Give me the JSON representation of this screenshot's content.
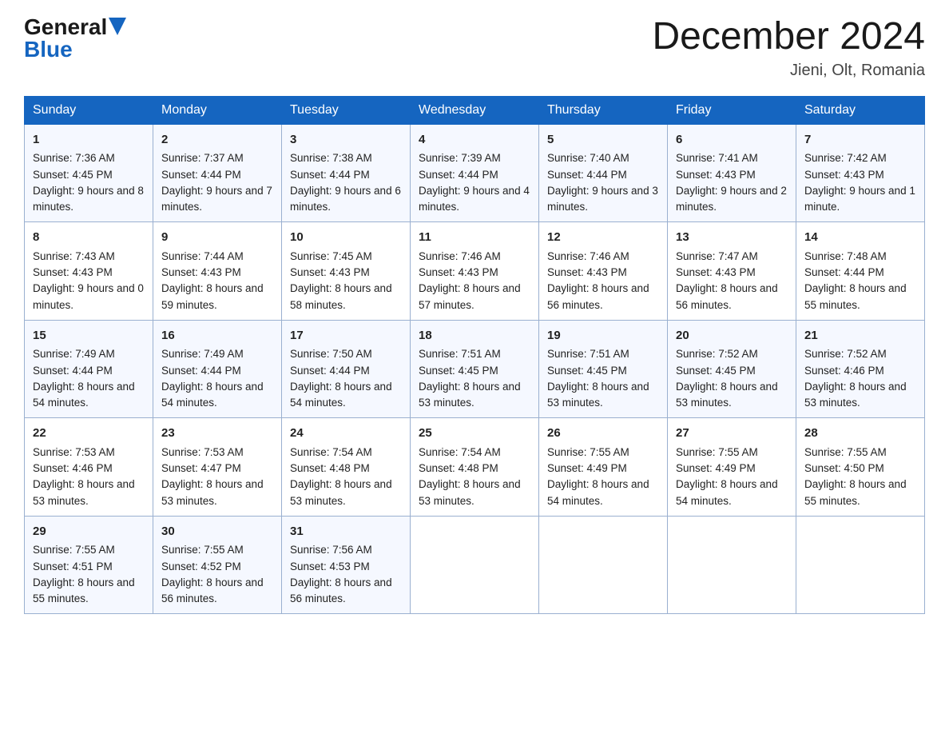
{
  "header": {
    "logo_general": "General",
    "logo_blue": "Blue",
    "title": "December 2024",
    "subtitle": "Jieni, Olt, Romania"
  },
  "days_of_week": [
    "Sunday",
    "Monday",
    "Tuesday",
    "Wednesday",
    "Thursday",
    "Friday",
    "Saturday"
  ],
  "weeks": [
    [
      {
        "day": "1",
        "sunrise": "7:36 AM",
        "sunset": "4:45 PM",
        "daylight": "9 hours and 8 minutes."
      },
      {
        "day": "2",
        "sunrise": "7:37 AM",
        "sunset": "4:44 PM",
        "daylight": "9 hours and 7 minutes."
      },
      {
        "day": "3",
        "sunrise": "7:38 AM",
        "sunset": "4:44 PM",
        "daylight": "9 hours and 6 minutes."
      },
      {
        "day": "4",
        "sunrise": "7:39 AM",
        "sunset": "4:44 PM",
        "daylight": "9 hours and 4 minutes."
      },
      {
        "day": "5",
        "sunrise": "7:40 AM",
        "sunset": "4:44 PM",
        "daylight": "9 hours and 3 minutes."
      },
      {
        "day": "6",
        "sunrise": "7:41 AM",
        "sunset": "4:43 PM",
        "daylight": "9 hours and 2 minutes."
      },
      {
        "day": "7",
        "sunrise": "7:42 AM",
        "sunset": "4:43 PM",
        "daylight": "9 hours and 1 minute."
      }
    ],
    [
      {
        "day": "8",
        "sunrise": "7:43 AM",
        "sunset": "4:43 PM",
        "daylight": "9 hours and 0 minutes."
      },
      {
        "day": "9",
        "sunrise": "7:44 AM",
        "sunset": "4:43 PM",
        "daylight": "8 hours and 59 minutes."
      },
      {
        "day": "10",
        "sunrise": "7:45 AM",
        "sunset": "4:43 PM",
        "daylight": "8 hours and 58 minutes."
      },
      {
        "day": "11",
        "sunrise": "7:46 AM",
        "sunset": "4:43 PM",
        "daylight": "8 hours and 57 minutes."
      },
      {
        "day": "12",
        "sunrise": "7:46 AM",
        "sunset": "4:43 PM",
        "daylight": "8 hours and 56 minutes."
      },
      {
        "day": "13",
        "sunrise": "7:47 AM",
        "sunset": "4:43 PM",
        "daylight": "8 hours and 56 minutes."
      },
      {
        "day": "14",
        "sunrise": "7:48 AM",
        "sunset": "4:44 PM",
        "daylight": "8 hours and 55 minutes."
      }
    ],
    [
      {
        "day": "15",
        "sunrise": "7:49 AM",
        "sunset": "4:44 PM",
        "daylight": "8 hours and 54 minutes."
      },
      {
        "day": "16",
        "sunrise": "7:49 AM",
        "sunset": "4:44 PM",
        "daylight": "8 hours and 54 minutes."
      },
      {
        "day": "17",
        "sunrise": "7:50 AM",
        "sunset": "4:44 PM",
        "daylight": "8 hours and 54 minutes."
      },
      {
        "day": "18",
        "sunrise": "7:51 AM",
        "sunset": "4:45 PM",
        "daylight": "8 hours and 53 minutes."
      },
      {
        "day": "19",
        "sunrise": "7:51 AM",
        "sunset": "4:45 PM",
        "daylight": "8 hours and 53 minutes."
      },
      {
        "day": "20",
        "sunrise": "7:52 AM",
        "sunset": "4:45 PM",
        "daylight": "8 hours and 53 minutes."
      },
      {
        "day": "21",
        "sunrise": "7:52 AM",
        "sunset": "4:46 PM",
        "daylight": "8 hours and 53 minutes."
      }
    ],
    [
      {
        "day": "22",
        "sunrise": "7:53 AM",
        "sunset": "4:46 PM",
        "daylight": "8 hours and 53 minutes."
      },
      {
        "day": "23",
        "sunrise": "7:53 AM",
        "sunset": "4:47 PM",
        "daylight": "8 hours and 53 minutes."
      },
      {
        "day": "24",
        "sunrise": "7:54 AM",
        "sunset": "4:48 PM",
        "daylight": "8 hours and 53 minutes."
      },
      {
        "day": "25",
        "sunrise": "7:54 AM",
        "sunset": "4:48 PM",
        "daylight": "8 hours and 53 minutes."
      },
      {
        "day": "26",
        "sunrise": "7:55 AM",
        "sunset": "4:49 PM",
        "daylight": "8 hours and 54 minutes."
      },
      {
        "day": "27",
        "sunrise": "7:55 AM",
        "sunset": "4:49 PM",
        "daylight": "8 hours and 54 minutes."
      },
      {
        "day": "28",
        "sunrise": "7:55 AM",
        "sunset": "4:50 PM",
        "daylight": "8 hours and 55 minutes."
      }
    ],
    [
      {
        "day": "29",
        "sunrise": "7:55 AM",
        "sunset": "4:51 PM",
        "daylight": "8 hours and 55 minutes."
      },
      {
        "day": "30",
        "sunrise": "7:55 AM",
        "sunset": "4:52 PM",
        "daylight": "8 hours and 56 minutes."
      },
      {
        "day": "31",
        "sunrise": "7:56 AM",
        "sunset": "4:53 PM",
        "daylight": "8 hours and 56 minutes."
      },
      null,
      null,
      null,
      null
    ]
  ]
}
